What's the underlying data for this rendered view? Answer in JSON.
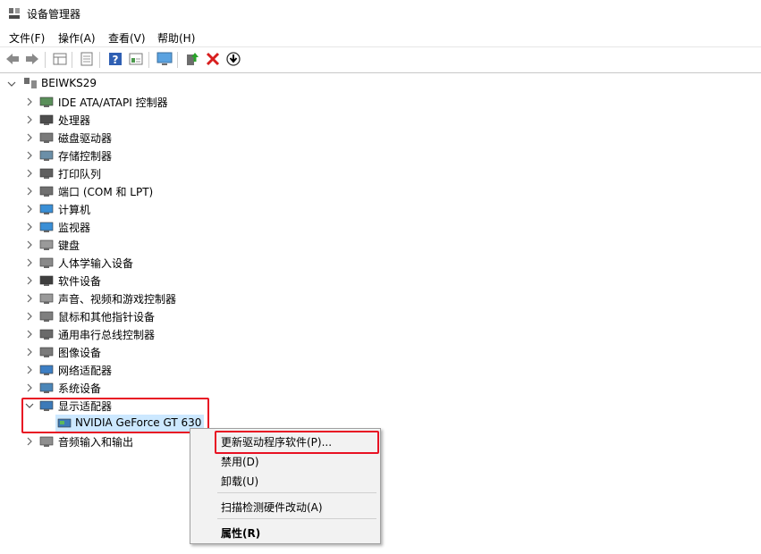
{
  "window": {
    "title": "设备管理器"
  },
  "menu": {
    "file": "文件(F)",
    "action": "操作(A)",
    "view": "查看(V)",
    "help": "帮助(H)"
  },
  "toolbar": {
    "icons": [
      "back-icon",
      "forward-icon",
      "properties-grid-icon",
      "show-hide-icon",
      "help-icon",
      "details-icon",
      "scan-monitor-icon",
      "update-driver-icon",
      "uninstall-icon",
      "download-icon"
    ]
  },
  "tree": {
    "root": "BEIWKS29",
    "items": [
      "IDE ATA/ATAPI 控制器",
      "处理器",
      "磁盘驱动器",
      "存储控制器",
      "打印队列",
      "端口 (COM 和 LPT)",
      "计算机",
      "监视器",
      "键盘",
      "人体学输入设备",
      "软件设备",
      "声音、视频和游戏控制器",
      "鼠标和其他指针设备",
      "通用串行总线控制器",
      "图像设备",
      "网络适配器",
      "系统设备",
      "显示适配器",
      "音频输入和输出"
    ],
    "child": "NVIDIA GeForce GT 630"
  },
  "context_menu": {
    "update": "更新驱动程序软件(P)...",
    "disable": "禁用(D)",
    "uninstall": "卸载(U)",
    "scan": "扫描检测硬件改动(A)",
    "properties": "属性(R)"
  },
  "colors": {
    "highlight": "#e81123",
    "selection": "#cce8ff"
  }
}
